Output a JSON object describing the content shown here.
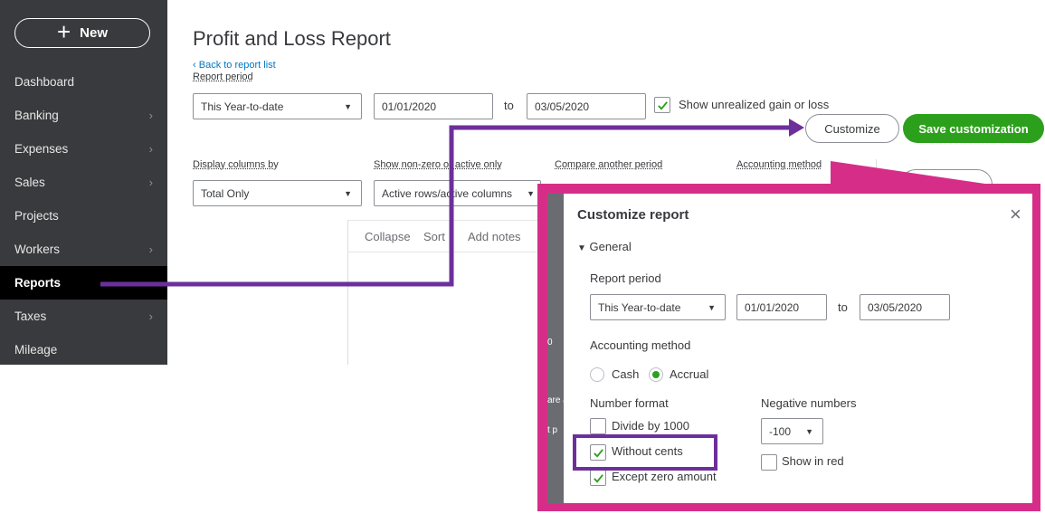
{
  "sidebar": {
    "new_button": "New",
    "items": [
      {
        "label": "Dashboard",
        "chevron": false
      },
      {
        "label": "Banking",
        "chevron": true
      },
      {
        "label": "Expenses",
        "chevron": true
      },
      {
        "label": "Sales",
        "chevron": true
      },
      {
        "label": "Projects",
        "chevron": false
      },
      {
        "label": "Workers",
        "chevron": true
      },
      {
        "label": "Reports",
        "chevron": false,
        "active": true
      },
      {
        "label": "Taxes",
        "chevron": true
      },
      {
        "label": "Mileage",
        "chevron": false
      }
    ]
  },
  "header": {
    "title": "Profit and Loss Report",
    "back_link": "Back to report list"
  },
  "filters": {
    "report_period_label": "Report period",
    "report_period_value": "This Year-to-date",
    "start_date": "01/01/2020",
    "to": "to",
    "end_date": "03/05/2020",
    "unrealized_label": "Show unrealized gain or loss",
    "customize_button": "Customize",
    "save_button": "Save customization",
    "display_columns_label": "Display columns by",
    "display_columns_value": "Total Only",
    "non_zero_label": "Show non-zero or active only",
    "non_zero_value": "Active rows/active columns",
    "compare_label": "Compare another period",
    "accounting_label": "Accounting method"
  },
  "toolbar": {
    "collapse": "Collapse",
    "sort": "Sort",
    "add_notes": "Add notes"
  },
  "peek": {
    "zero": "0",
    "are": "are a",
    "tp": "t p"
  },
  "customize_panel": {
    "title": "Customize report",
    "section": "General",
    "report_period_label": "Report period",
    "report_period_value": "This Year-to-date",
    "start_date": "01/01/2020",
    "to": "to",
    "end_date": "03/05/2020",
    "accounting_method_label": "Accounting method",
    "cash": "Cash",
    "accrual": "Accrual",
    "number_format_label": "Number format",
    "divide_by_1000": "Divide by 1000",
    "without_cents": "Without cents",
    "except_zero": "Except zero amount",
    "negative_numbers_label": "Negative numbers",
    "negative_format": "-100",
    "show_in_red": "Show in red"
  },
  "colors": {
    "sidebar_bg": "#393a3d",
    "active_nav_bg": "#000000",
    "primary_green": "#2ca01c",
    "link_blue": "#0077c5",
    "annotation_purple": "#6c2f9b",
    "annotation_magenta": "#d62e88"
  }
}
